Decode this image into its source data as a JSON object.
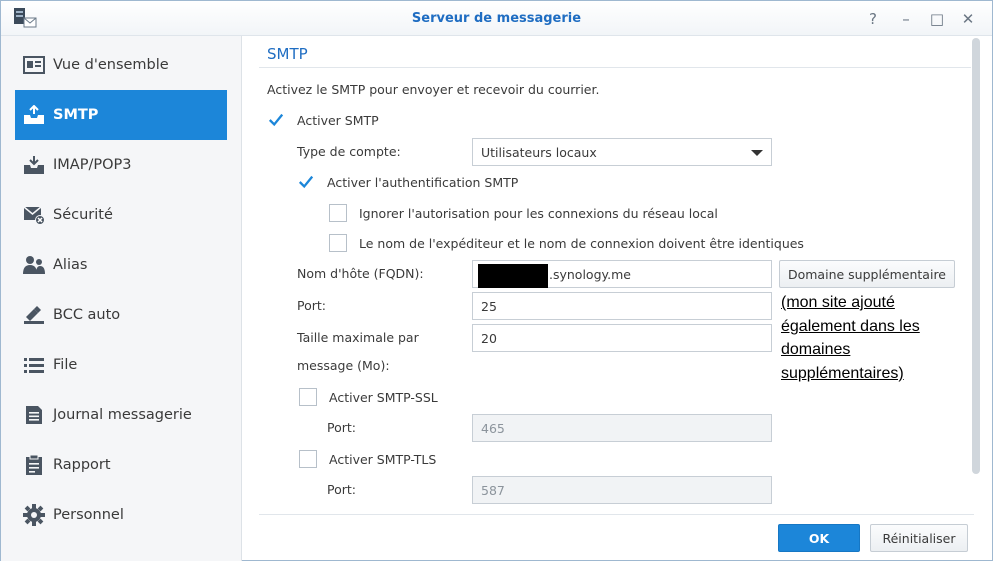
{
  "window": {
    "title": "Serveur de messagerie",
    "controls": [
      "?",
      "–",
      "□",
      "✕"
    ]
  },
  "sidebar": {
    "items": [
      {
        "label": "Vue d'ensemble",
        "icon": "overview-icon"
      },
      {
        "label": "SMTP",
        "icon": "smtp-inbox-icon",
        "active": true
      },
      {
        "label": "IMAP/POP3",
        "icon": "imap-download-icon"
      },
      {
        "label": "Sécurité",
        "icon": "security-mail-icon"
      },
      {
        "label": "Alias",
        "icon": "alias-users-icon"
      },
      {
        "label": "BCC auto",
        "icon": "bcc-icon"
      },
      {
        "label": "File",
        "icon": "queue-list-icon"
      },
      {
        "label": "Journal messagerie",
        "icon": "mail-log-icon"
      },
      {
        "label": "Rapport",
        "icon": "report-clipboard-icon"
      },
      {
        "label": "Personnel",
        "icon": "personal-gear-icon"
      }
    ]
  },
  "main": {
    "section_title": "SMTP",
    "description": "Activez le SMTP pour envoyer et recevoir du courrier.",
    "enable_smtp": {
      "label": "Activer SMTP",
      "checked": true
    },
    "account_type": {
      "label": "Type de compte:",
      "value": "Utilisateurs locaux"
    },
    "smtp_auth": {
      "label": "Activer l'authentification SMTP",
      "checked": true
    },
    "ignore_auth_local": {
      "label": "Ignorer l'autorisation pour les connexions du réseau local",
      "checked": false
    },
    "sender_login_identical": {
      "label": "Le nom de l'expéditeur et le nom de connexion doivent être identiques",
      "checked": false
    },
    "hostname": {
      "label": "Nom d'hôte (FQDN):",
      "value_suffix": ".synology.me"
    },
    "extra_domain_button": "Domaine supplémentaire",
    "port": {
      "label": "Port:",
      "value": "25"
    },
    "max_size": {
      "label_line1": "Taille maximale par",
      "label_line2": "message (Mo):",
      "value": "20"
    },
    "smtp_ssl": {
      "label": "Activer SMTP-SSL",
      "checked": false,
      "port_label": "Port:",
      "port_value": "465"
    },
    "smtp_tls": {
      "label": "Activer SMTP-TLS",
      "checked": false,
      "port_label": "Port:",
      "port_value": "587"
    },
    "annotation_lines": [
      "(mon site ajouté",
      "également dans les",
      "domaines",
      "supplémentaires)"
    ]
  },
  "footer": {
    "ok_label": "OK",
    "reset_label": "Réinitialiser"
  },
  "colors": {
    "accent": "#1c86d9",
    "title_blue": "#1f6dc2"
  }
}
